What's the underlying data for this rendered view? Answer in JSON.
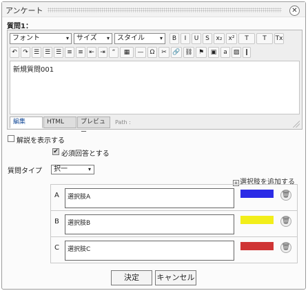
{
  "dialog": {
    "title": "アンケート",
    "close_glyph": "✕"
  },
  "question": {
    "label": "質問1：",
    "body": "新規質問001"
  },
  "editor": {
    "font_select": "フォント",
    "size_select": "サイズ",
    "style_select": "スタイル",
    "dropdown_glyph": "▾",
    "row1_buttons": [
      {
        "name": "bold-button",
        "glyph": "B"
      },
      {
        "name": "italic-button",
        "glyph": "I"
      },
      {
        "name": "underline-button",
        "glyph": "U"
      },
      {
        "name": "strike-button",
        "glyph": "S"
      },
      {
        "name": "subscript-button",
        "glyph": "x₂"
      },
      {
        "name": "superscript-button",
        "glyph": "x²"
      },
      {
        "name": "text-color-button",
        "glyph": "T"
      },
      {
        "name": "background-color-button",
        "glyph": "T"
      },
      {
        "name": "remove-format-button",
        "glyph": "Tx"
      }
    ],
    "row2_buttons": [
      {
        "name": "undo-button",
        "glyph": "↶"
      },
      {
        "name": "redo-button",
        "glyph": "↷"
      },
      {
        "name": "align-left-button",
        "glyph": "☰"
      },
      {
        "name": "align-center-button",
        "glyph": "☰"
      },
      {
        "name": "align-right-button",
        "glyph": "☰"
      },
      {
        "name": "ordered-list-button",
        "glyph": "≡"
      },
      {
        "name": "unordered-list-button",
        "glyph": "≡"
      },
      {
        "name": "outdent-button",
        "glyph": "⇤"
      },
      {
        "name": "indent-button",
        "glyph": "⇥"
      },
      {
        "name": "blockquote-button",
        "glyph": "“"
      },
      {
        "name": "table-button",
        "glyph": "▦"
      },
      {
        "name": "horizontal-rule-button",
        "glyph": "—"
      },
      {
        "name": "special-char-button",
        "glyph": "Ω"
      },
      {
        "name": "clean-button",
        "glyph": "✂"
      },
      {
        "name": "link-button",
        "glyph": "🔗"
      },
      {
        "name": "unlink-button",
        "glyph": "⛓"
      },
      {
        "name": "anchor-button",
        "glyph": "⚑"
      },
      {
        "name": "media-button",
        "glyph": "▣"
      },
      {
        "name": "font-button",
        "glyph": "a"
      },
      {
        "name": "image-button",
        "glyph": "▨"
      },
      {
        "name": "attach-button",
        "glyph": "❙"
      }
    ],
    "tabs": [
      "編集",
      "HTML",
      "プレビュー"
    ],
    "path_label": "Path :"
  },
  "options": {
    "show_explanation": "解説を表示する",
    "required": "必須回答とする",
    "question_type_label": "質問タイプ",
    "question_type_value": "択一",
    "add_choice": "選択肢を追加する"
  },
  "choices": [
    {
      "letter": "A",
      "text": "選択肢A",
      "color": "#2b2be6"
    },
    {
      "letter": "B",
      "text": "選択肢B",
      "color": "#f2ee1a"
    },
    {
      "letter": "C",
      "text": "選択肢C",
      "color": "#cf3535"
    }
  ],
  "buttons": {
    "ok": "決定",
    "cancel": "キャンセル"
  }
}
